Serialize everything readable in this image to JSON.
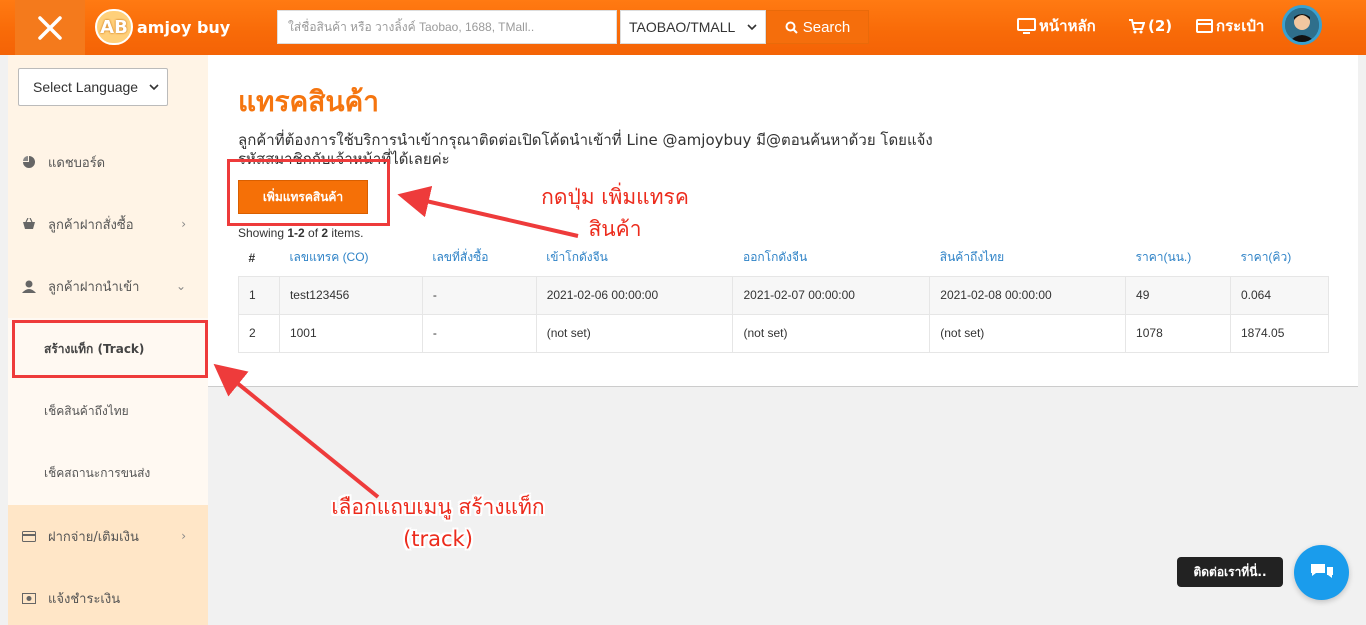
{
  "header": {
    "logo_mark": "AB",
    "logo_text": "amjoy buy",
    "search_placeholder": "ใส่ชื่อสินค้า หรือ วางลิ้งค์ Taobao, 1688, TMall..",
    "platform_select": "TAOBAO/TMALL",
    "search_label": "Search",
    "nav_home": "หน้าหลัก",
    "nav_cart": "(2)",
    "nav_wallet": "กระเป๋า"
  },
  "sidebar": {
    "language_select": "Select Language",
    "items": [
      {
        "label": "แดชบอร์ด"
      },
      {
        "label": "ลูกค้าฝากสั่งซื้อ"
      },
      {
        "label": "ลูกค้าฝากนำเข้า"
      }
    ],
    "sub_items": [
      {
        "label": "สร้างแท็ก (Track)"
      },
      {
        "label": "เช็คสินค้าถึงไทย"
      },
      {
        "label": "เช็คสถานะการขนส่ง"
      }
    ],
    "bottom_items": [
      {
        "label": "ฝากจ่าย/เติมเงิน"
      },
      {
        "label": "แจ้งชำระเงิน"
      }
    ]
  },
  "main": {
    "title": "แทรคสินค้า",
    "description": "ลูกค้าที่ต้องการใช้บริการนำเข้ากรุณาติดต่อเปิดโค้ดนำเข้าที่ Line @amjoybuy มี@ตอนค้นหาด้วย โดยแจ้งรหัสสมาชิกกับเจ้าหน้าที่ได้เลยค่ะ",
    "add_button": "เพิ่มแทรคสินค้า",
    "summary_prefix": "Showing ",
    "summary_range": "1-2",
    "summary_mid": " of ",
    "summary_total": "2",
    "summary_suffix": " items.",
    "columns": [
      "#",
      "เลขแทรค (CO)",
      "เลขที่สั่งซื้อ",
      "เข้าโกดังจีน",
      "ออกโกดังจีน",
      "สินค้าถึงไทย",
      "ราคา(นน.)",
      "ราคา(คิว)"
    ],
    "rows": [
      [
        "1",
        "test123456",
        "-",
        "2021-02-06 00:00:00",
        "2021-02-07 00:00:00",
        "2021-02-08 00:00:00",
        "49",
        "0.064"
      ],
      [
        "2",
        "1001",
        "-",
        "(not set)",
        "(not set)",
        "(not set)",
        "1078",
        "1874.05"
      ]
    ]
  },
  "annotations": {
    "add_hint_line1": "กดปุ่ม เพิ่มแทรค",
    "add_hint_line2": "สินค้า",
    "menu_hint_line1": "เลือกแถบเมนู สร้างแท็ก",
    "menu_hint_line2": "(track)",
    "color": "#ee3b3b"
  },
  "chat": {
    "label": "ติดต่อเราที่นี่.."
  },
  "colors": {
    "brand_orange": "#f86a08",
    "link_blue": "#2f83c7",
    "chat_blue": "#1a9cec"
  }
}
